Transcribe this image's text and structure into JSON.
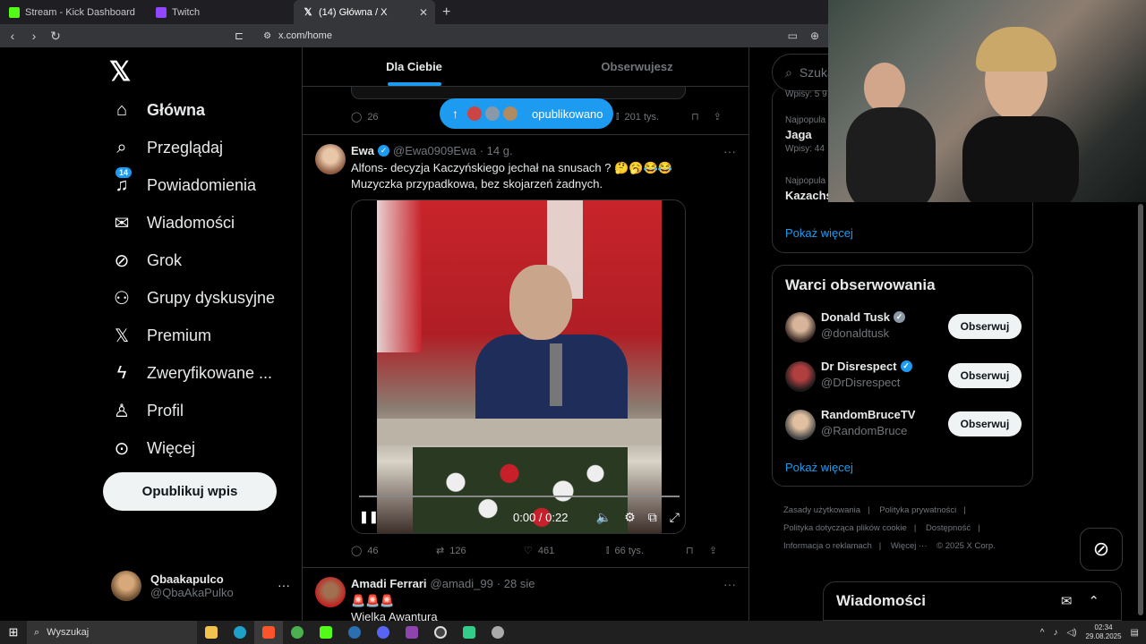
{
  "browser": {
    "tabs": [
      {
        "label": "Stream - Kick Dashboard",
        "favicon_color": "#53fc18"
      },
      {
        "label": "Twitch",
        "favicon_color": "#9146ff"
      },
      {
        "label": "(14) Główna / X",
        "favicon_color": "#000000"
      }
    ],
    "url": "x.com/home"
  },
  "leftnav": {
    "items": [
      {
        "label": "Główna",
        "icon": "home-icon"
      },
      {
        "label": "Przeglądaj",
        "icon": "search-icon"
      },
      {
        "label": "Powiadomienia",
        "icon": "bell-icon",
        "badge": "14"
      },
      {
        "label": "Wiadomości",
        "icon": "mail-icon"
      },
      {
        "label": "Grok",
        "icon": "grok-icon"
      },
      {
        "label": "Grupy dyskusyjne",
        "icon": "people-icon"
      },
      {
        "label": "Premium",
        "icon": "x-icon"
      },
      {
        "label": "Zweryfikowane ...",
        "icon": "bolt-icon"
      },
      {
        "label": "Profil",
        "icon": "person-icon"
      },
      {
        "label": "Więcej",
        "icon": "more-icon"
      }
    ],
    "post_button": "Opublikuj wpis",
    "account": {
      "name": "Qbaakapulco",
      "handle": "@QbaAkaPulko"
    }
  },
  "feed": {
    "tabs": [
      "Dla Ciebie",
      "Obserwujesz"
    ],
    "top_actions": {
      "replies": "26",
      "views": "201 tys."
    },
    "pill": "opublikowano",
    "post1": {
      "name": "Ewa",
      "handle": "@Ewa0909Ewa",
      "time": "· 14 g.",
      "line1": "Alfons- decyzja Kaczyńskiego jechał na snusach ? 🤔🥱😂😂",
      "line2": "Muzyczka przypadkowa, bez skojarzeń żadnych.",
      "video_time": "0:00 / 0:22",
      "replies": "46",
      "reposts": "126",
      "likes": "461",
      "views": "66 tys."
    },
    "post2": {
      "name": "Amadi Ferrari",
      "handle": "@amadi_99",
      "time": "· 28 sie",
      "line1": "🚨🚨🚨",
      "line2": "Wielka Awantura"
    }
  },
  "right": {
    "search_placeholder": "Szukaj",
    "trends": [
      {
        "category": "",
        "title": "",
        "count": "Wpisy: 5 9"
      },
      {
        "category": "Najpopula",
        "title": "Jaga",
        "count": "Wpisy: 44"
      },
      {
        "category": "Najpopula",
        "title": "Kazachs",
        "count": ""
      }
    ],
    "show_more": "Pokaż więcej",
    "who_title": "Warci obserwowania",
    "who": [
      {
        "name": "Donald Tusk",
        "handle": "@donaldtusk",
        "button": "Obserwuj"
      },
      {
        "name": "Dr Disrespect",
        "handle": "@DrDisrespect",
        "button": "Obserwuj"
      },
      {
        "name": "RandomBruceTV",
        "handle": "@RandomBruce",
        "button": "Obserwuj"
      }
    ],
    "footer": [
      "Zasady użytkowania",
      "|",
      "Polityka prywatności",
      "|",
      "Polityka dotycząca plików cookie",
      "|",
      "Dostępność",
      "|",
      "Informacja o reklamach",
      "|",
      "Więcej ···",
      "© 2025 X Corp."
    ],
    "messages_title": "Wiadomości"
  },
  "taskbar": {
    "search": "Wyszukaj",
    "time": "02:34",
    "date": "29.08.2025"
  }
}
